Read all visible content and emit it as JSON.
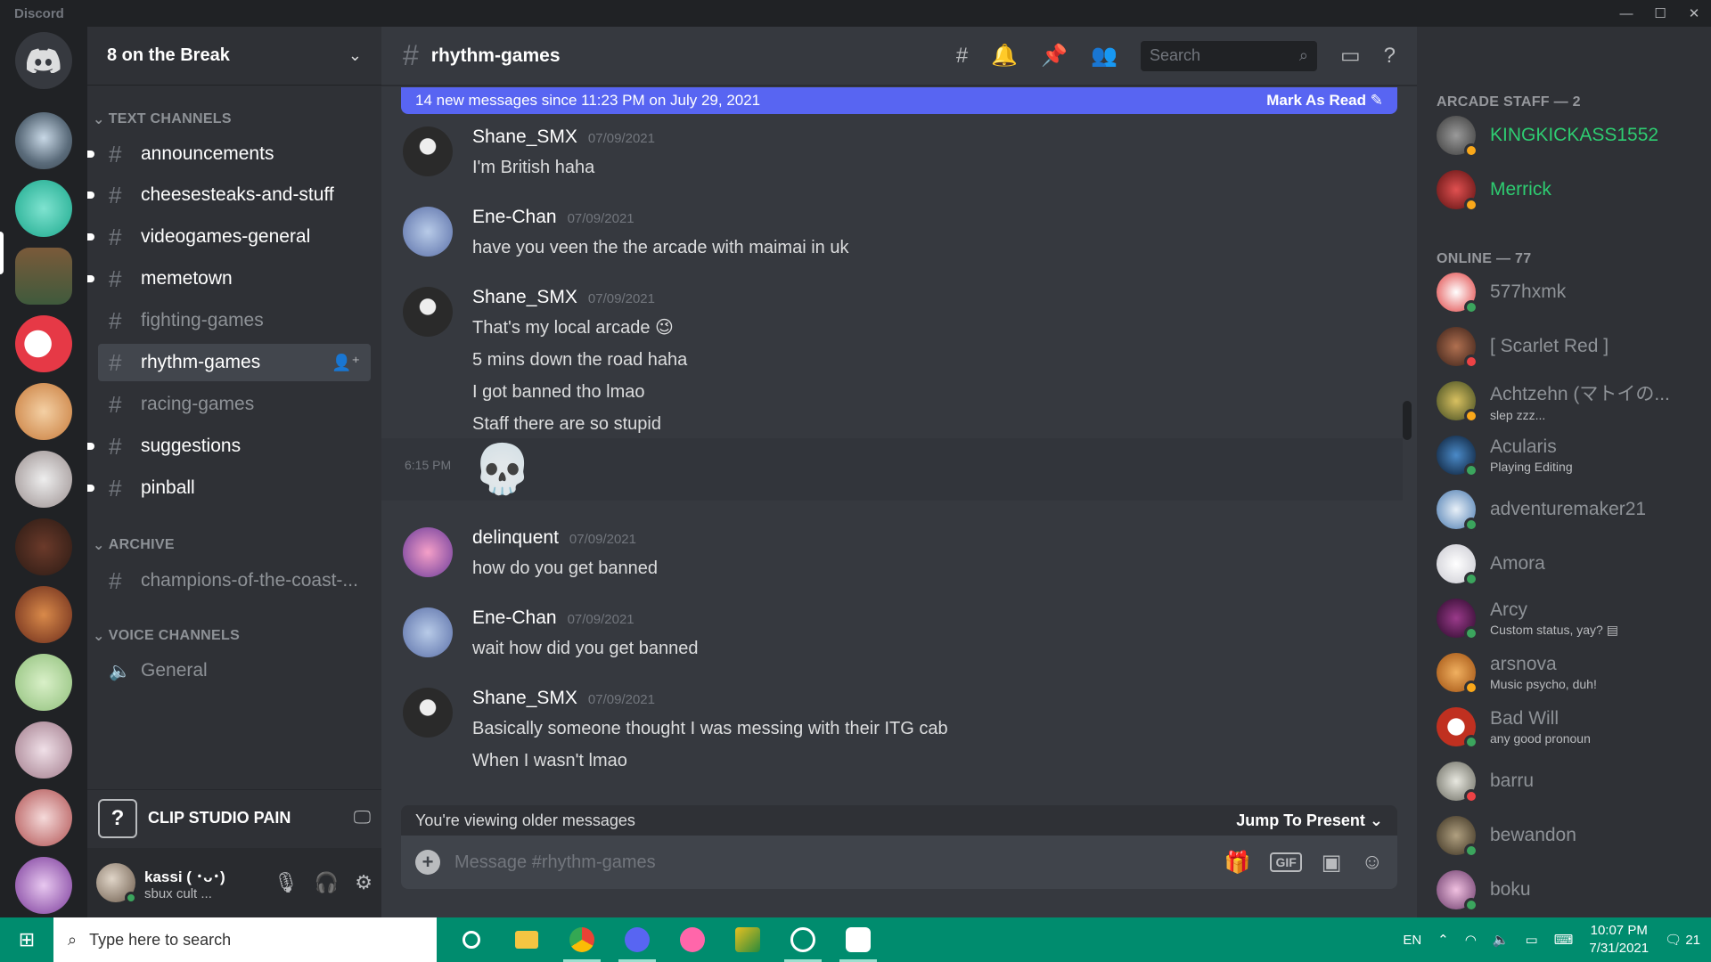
{
  "app": {
    "name": "Discord"
  },
  "window": {
    "minimize": "—",
    "maximize": "☐",
    "close": "✕"
  },
  "guild": {
    "name": "8 on the Break",
    "categories": {
      "text": "TEXT CHANNELS",
      "archive": "ARCHIVE",
      "voice": "VOICE CHANNELS"
    },
    "channels": [
      {
        "name": "announcements",
        "state": "unread"
      },
      {
        "name": "cheesesteaks-and-stuff",
        "state": "unread"
      },
      {
        "name": "videogames-general",
        "state": "unread"
      },
      {
        "name": "memetown",
        "state": "unread"
      },
      {
        "name": "fighting-games",
        "state": "read"
      },
      {
        "name": "rhythm-games",
        "state": "active"
      },
      {
        "name": "racing-games",
        "state": "read"
      },
      {
        "name": "suggestions",
        "state": "unread"
      },
      {
        "name": "pinball",
        "state": "unread"
      }
    ],
    "archive_channels": [
      {
        "name": "champions-of-the-coast-..."
      }
    ],
    "voice_channels": [
      {
        "name": "General"
      }
    ]
  },
  "activity": {
    "label": "CLIP STUDIO PAIN",
    "icon": "?"
  },
  "user": {
    "name": "kassi ( ･ᴗ･)",
    "status": "sbux cult ..."
  },
  "chat": {
    "channel": "rhythm-games",
    "search_placeholder": "Search",
    "new_banner": {
      "text": "14 new messages since 11:23 PM on July 29, 2021",
      "action": "Mark As Read"
    },
    "messages": [
      {
        "author": "Shane_SMX",
        "date": "07/09/2021",
        "lines": [
          "I'm British haha"
        ]
      },
      {
        "author": "Ene-Chan",
        "date": "07/09/2021",
        "lines": [
          "have you veen the the arcade with maimai in uk"
        ]
      },
      {
        "author": "Shane_SMX",
        "date": "07/09/2021",
        "lines": [
          "That's my local arcade 😉",
          "5 mins down the road haha",
          "I got banned tho lmao",
          "Staff there are so stupid"
        ]
      },
      {
        "author": "delinquent",
        "date": "07/09/2021",
        "lines": [
          "how do you get banned"
        ]
      },
      {
        "author": "Ene-Chan",
        "date": "07/09/2021",
        "lines": [
          "wait how did you get banned"
        ]
      },
      {
        "author": "Shane_SMX",
        "date": "07/09/2021",
        "lines": [
          "Basically someone thought I was messing with their ITG cab",
          "When I wasn't lmao"
        ]
      }
    ],
    "followup": {
      "time": "6:15 PM",
      "emoji": "💀"
    },
    "older_bar": {
      "text": "You're viewing older messages",
      "action": "Jump To Present"
    },
    "composer_placeholder": "Message #rhythm-games",
    "gif_label": "GIF"
  },
  "members": {
    "staff_header": "ARCADE STAFF — 2",
    "online_header": "ONLINE — 77",
    "staff": [
      {
        "name": "KINGKICKASS1552",
        "status_color": "#faa81a",
        "name_color": "#2ecc71"
      },
      {
        "name": "Merrick",
        "status_color": "#faa81a",
        "name_color": "#2ecc71"
      }
    ],
    "online": [
      {
        "name": "577hxmk",
        "sub": "",
        "status_color": "#3ba55d"
      },
      {
        "name": "[ Scarlet Red ]",
        "sub": "",
        "status_color": "#ed4245"
      },
      {
        "name": "Achtzehn (マトイの...",
        "sub": "slep zzz...",
        "status_color": "#faa81a"
      },
      {
        "name": "Acularis",
        "sub": "Playing Editing",
        "status_color": "#3ba55d"
      },
      {
        "name": "adventuremaker21",
        "sub": "",
        "status_color": "#3ba55d"
      },
      {
        "name": "Amora",
        "sub": "",
        "status_color": "#3ba55d"
      },
      {
        "name": "Arcy",
        "sub": "Custom status, yay? ▤",
        "status_color": "#3ba55d"
      },
      {
        "name": "arsnova",
        "sub": "Music psycho, duh!",
        "status_color": "#faa81a"
      },
      {
        "name": "Bad Will",
        "sub": "any good pronoun",
        "status_color": "#3ba55d"
      },
      {
        "name": "barru",
        "sub": "",
        "status_color": "#ed4245"
      },
      {
        "name": "bewandon",
        "sub": "",
        "status_color": "#3ba55d"
      },
      {
        "name": "boku",
        "sub": "",
        "status_color": "#3ba55d"
      }
    ]
  },
  "taskbar": {
    "search_placeholder": "Type here to search",
    "lang": "EN",
    "time": "10:07 PM",
    "date": "7/31/2021",
    "notif_count": "21"
  }
}
